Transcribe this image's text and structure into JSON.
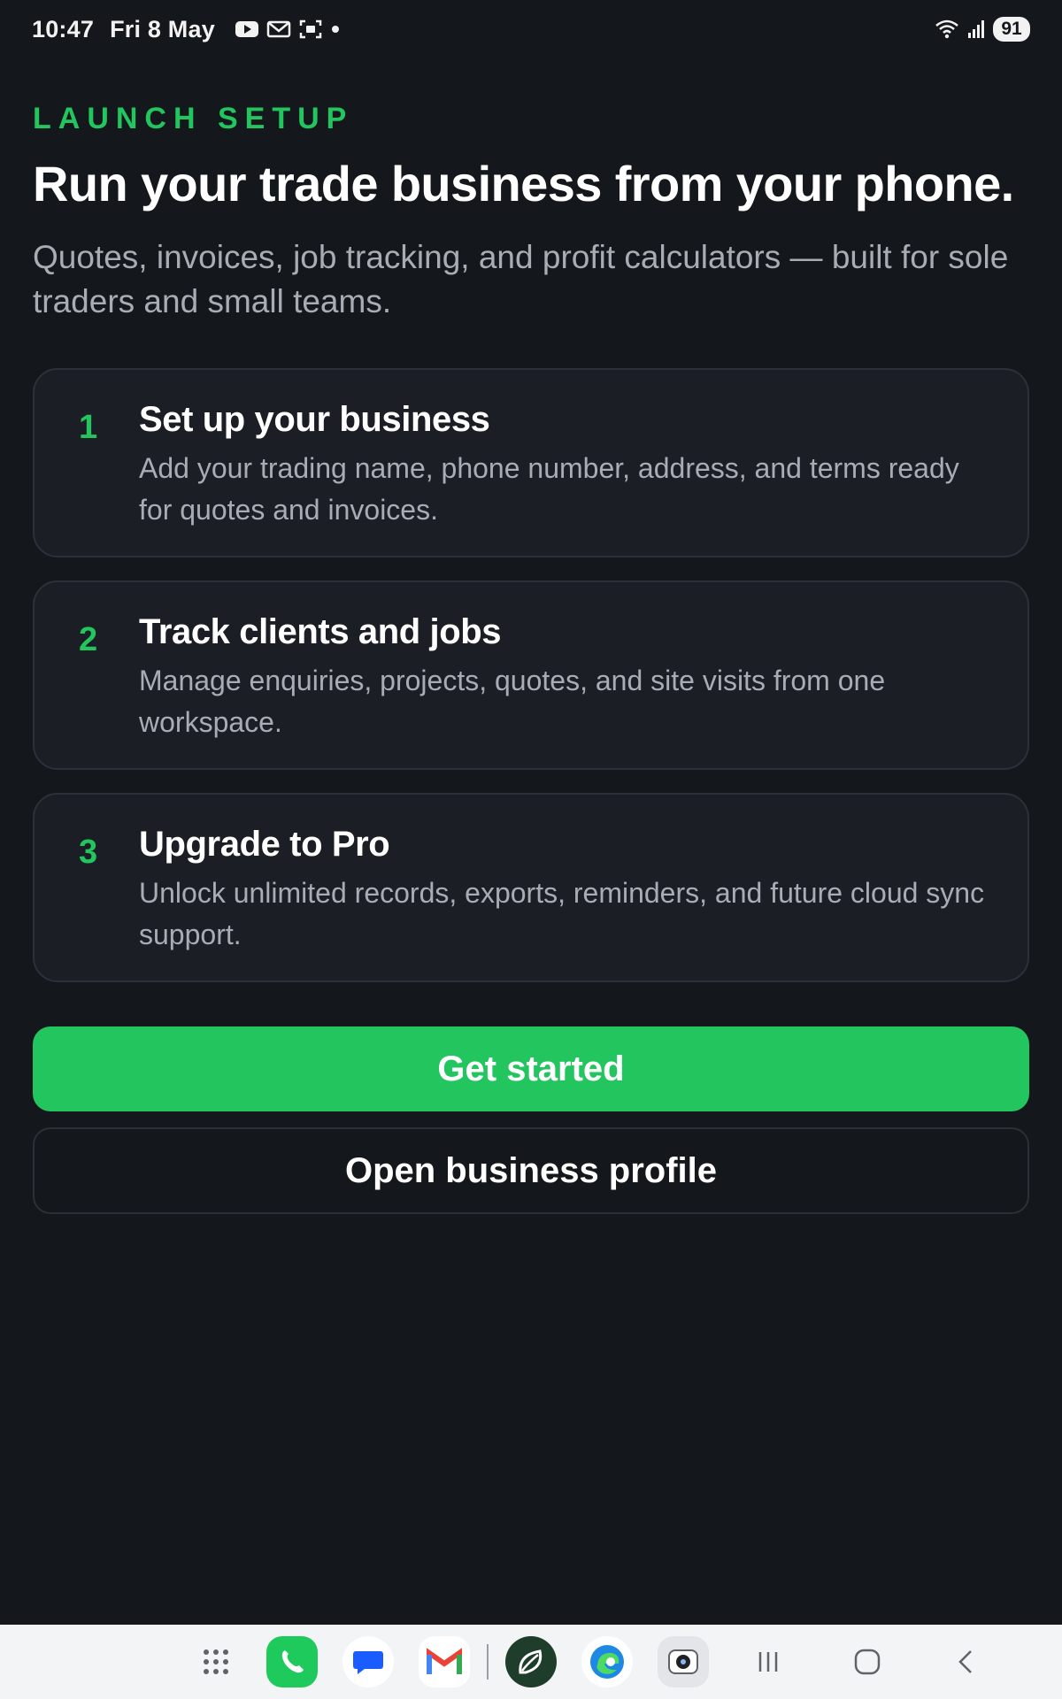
{
  "status_bar": {
    "time": "10:47",
    "date": "Fri 8 May",
    "icons": [
      "youtube-icon",
      "gmail-icon",
      "screenshot-icon",
      "dot-icon"
    ],
    "right_icons": [
      "wifi-icon",
      "signal-icon"
    ],
    "battery": "91"
  },
  "header": {
    "eyebrow": "LAUNCH SETUP",
    "title": "Run your trade business from your phone.",
    "subtitle": "Quotes, invoices, job tracking, and profit calculators — built for sole traders and small teams."
  },
  "steps": [
    {
      "number": "1",
      "title": "Set up your business",
      "description": "Add your trading name, phone number, address, and terms ready for quotes and invoices."
    },
    {
      "number": "2",
      "title": "Track clients and jobs",
      "description": "Manage enquiries, projects, quotes, and site visits from one workspace."
    },
    {
      "number": "3",
      "title": "Upgrade to Pro",
      "description": "Unlock unlimited records, exports, reminders, and future cloud sync support."
    }
  ],
  "actions": {
    "primary_label": "Get started",
    "secondary_label": "Open business profile"
  },
  "dock": {
    "apps": [
      "app-drawer-icon",
      "phone-app-icon",
      "messages-app-icon",
      "gmail-app-icon",
      "leaf-app-icon",
      "edge-app-icon",
      "camera-app-icon"
    ],
    "nav": [
      "recents-icon",
      "home-icon",
      "back-icon"
    ]
  },
  "colors": {
    "background": "#14171b",
    "card": "#1b1f25",
    "border": "#2b313a",
    "accent": "#22c55e",
    "muted_text": "#a8adb5"
  }
}
